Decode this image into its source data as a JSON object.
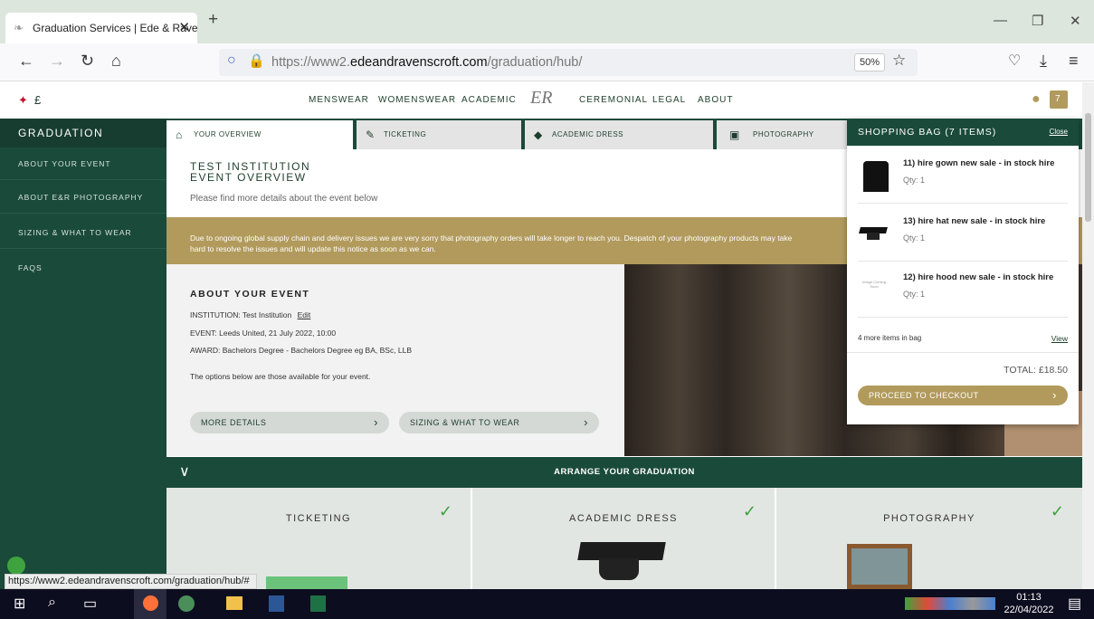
{
  "browser": {
    "tab_title": "Graduation Services | Ede & Ravenscroft",
    "url_prefix": "https://www2.",
    "url_domain": "edeandravenscroft.com",
    "url_path": "/graduation/hub/",
    "zoom": "50%",
    "status_url": "https://www2.edeandravenscroft.com/graduation/hub/#"
  },
  "site": {
    "currency": "£",
    "logo": "ER",
    "nav": [
      "MENSWEAR",
      "WOMENSWEAR",
      "ACADEMIC",
      "CEREMONIAL",
      "LEGAL",
      "ABOUT"
    ],
    "bag_count": "7"
  },
  "sidebar": {
    "title": "GRADUATION",
    "items": [
      "ABOUT YOUR EVENT",
      "ABOUT E&R PHOTOGRAPHY",
      "SIZING & WHAT TO WEAR",
      "FAQS"
    ]
  },
  "tabs": [
    "YOUR OVERVIEW",
    "TICKETING",
    "ACADEMIC DRESS",
    "PHOTOGRAPHY"
  ],
  "overview": {
    "title_line1": "TEST INSTITUTION",
    "title_line2": "EVENT OVERVIEW",
    "subtitle": "Please find more details about the event below"
  },
  "notice": {
    "line1": "Due to ongoing global supply chain and delivery issues we are very sorry that photography orders will take longer to reach you. Despatch of your photography products may take",
    "line2": "hard to resolve the issues and will update this notice as soon as we can."
  },
  "event": {
    "heading": "ABOUT YOUR EVENT",
    "institution": "INSTITUTION: Test Institution",
    "edit": "Edit",
    "event": "EVENT: Leeds United, 21 July 2022, 10:00",
    "award": "AWARD: Bachelors Degree - Bachelors Degree eg BA, BSc, LLB",
    "options": "The options below are those available for your event.",
    "more_details": "MORE DETAILS",
    "sizing": "SIZING & WHAT TO WEAR"
  },
  "arrange": {
    "title": "ARRANGE YOUR GRADUATION",
    "cards": [
      "TICKETING",
      "ACADEMIC DRESS",
      "PHOTOGRAPHY"
    ]
  },
  "bag": {
    "title": "SHOPPING BAG (7 ITEMS)",
    "close": "Close",
    "items": [
      {
        "name": "11) hire gown new sale - in stock hire",
        "qty": "Qty: 1"
      },
      {
        "name": "13) hire hat new sale - in stock hire",
        "qty": "Qty: 1"
      },
      {
        "name": "12) hire hood new sale - in stock hire",
        "qty": "Qty: 1"
      }
    ],
    "placeholder_text": "Image Coming Soon",
    "more": "4 more items in bag",
    "view": "View",
    "total": "TOTAL: £18.50",
    "checkout": "PROCEED TO CHECKOUT"
  },
  "taskbar": {
    "time": "01:13",
    "date": "22/04/2022"
  },
  "colors": {
    "brand_green": "#1a4a3a",
    "gold": "#b19a5c",
    "tick": "#3ea33e"
  }
}
